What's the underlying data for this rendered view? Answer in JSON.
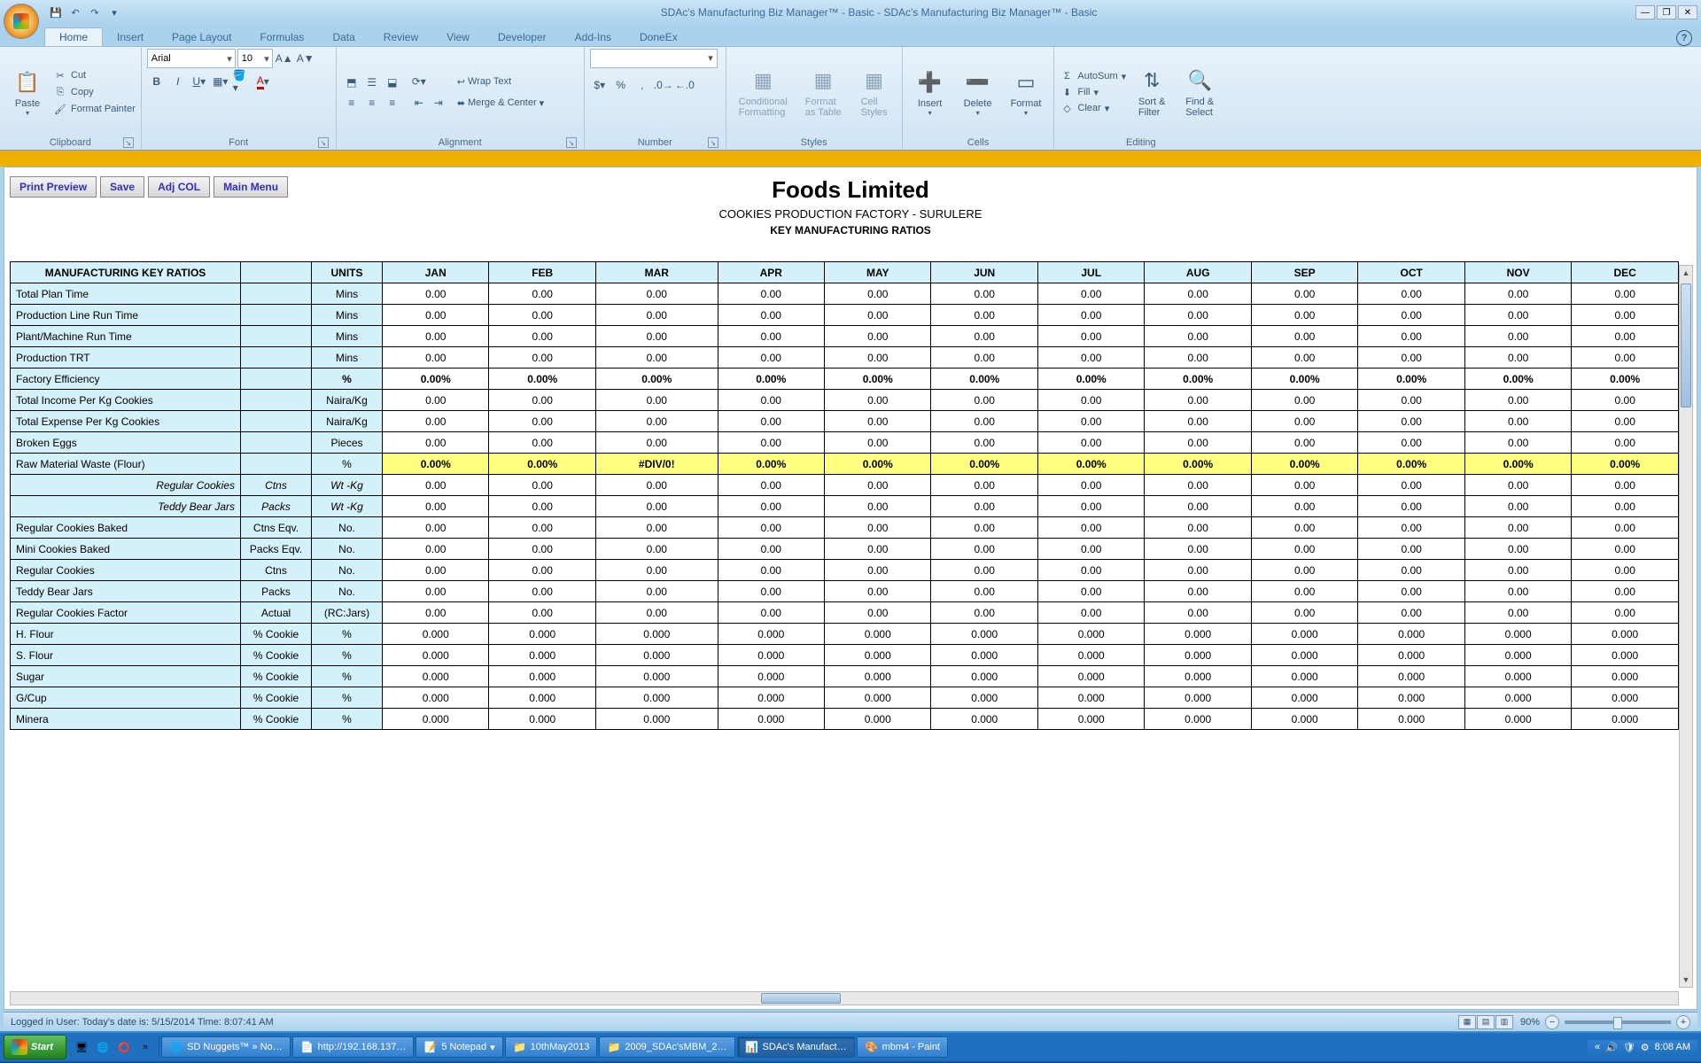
{
  "window": {
    "title": "SDAc's Manufacturing Biz Manager™ - Basic - SDAc's Manufacturing Biz Manager™ - Basic"
  },
  "ribbon": {
    "tabs": [
      "Home",
      "Insert",
      "Page Layout",
      "Formulas",
      "Data",
      "Review",
      "View",
      "Developer",
      "Add-Ins",
      "DoneEx"
    ],
    "active_tab": "Home",
    "clipboard": {
      "label": "Clipboard",
      "paste": "Paste",
      "cut": "Cut",
      "copy": "Copy",
      "fpainter": "Format Painter"
    },
    "font": {
      "label": "Font",
      "name": "Arial",
      "size": "10"
    },
    "alignment": {
      "label": "Alignment",
      "wrap": "Wrap Text",
      "merge": "Merge & Center"
    },
    "number": {
      "label": "Number"
    },
    "styles": {
      "label": "Styles",
      "cond": "Conditional\nFormatting",
      "table": "Format\nas Table",
      "cell": "Cell\nStyles"
    },
    "cells": {
      "label": "Cells",
      "insert": "Insert",
      "delete": "Delete",
      "format": "Format"
    },
    "editing": {
      "label": "Editing",
      "autosum": "AutoSum",
      "fill": "Fill",
      "clear": "Clear",
      "sort": "Sort &\nFilter",
      "find": "Find &\nSelect"
    }
  },
  "sheet_buttons": {
    "preview": "Print Preview",
    "save": "Save",
    "adj": "Adj COL",
    "main": "Main Menu"
  },
  "report": {
    "company": "Foods Limited",
    "factory": "COOKIES PRODUCTION FACTORY - SURULERE",
    "title": "KEY MANUFACTURING RATIOS",
    "head_main": "MANUFACTURING KEY RATIOS",
    "head_units": "UNITS",
    "months": [
      "JAN",
      "FEB",
      "MAR",
      "APR",
      "MAY",
      "JUN",
      "JUL",
      "AUG",
      "SEP",
      "OCT",
      "NOV",
      "DEC"
    ]
  },
  "rows": [
    {
      "label": "Total Plan Time",
      "col2": "",
      "unit": "Mins",
      "fmt": "0.00",
      "vals": [
        0,
        0,
        0,
        0,
        0,
        0,
        0,
        0,
        0,
        0,
        0,
        0
      ]
    },
    {
      "label": "Production Line Run Time",
      "col2": "",
      "unit": "Mins",
      "fmt": "0.00",
      "vals": [
        0,
        0,
        0,
        0,
        0,
        0,
        0,
        0,
        0,
        0,
        0,
        0
      ]
    },
    {
      "label": "Plant/Machine Run Time",
      "col2": "",
      "unit": "Mins",
      "fmt": "0.00",
      "vals": [
        0,
        0,
        0,
        0,
        0,
        0,
        0,
        0,
        0,
        0,
        0,
        0
      ]
    },
    {
      "label": "Production TRT",
      "col2": "",
      "unit": "Mins",
      "fmt": "0.00",
      "vals": [
        0,
        0,
        0,
        0,
        0,
        0,
        0,
        0,
        0,
        0,
        0,
        0
      ]
    },
    {
      "label": "Factory Efficiency",
      "col2": "",
      "unit": "%",
      "fmt": "0.00%",
      "bold": true,
      "vals": [
        0,
        0,
        0,
        0,
        0,
        0,
        0,
        0,
        0,
        0,
        0,
        0
      ]
    },
    {
      "label": "Total Income Per Kg Cookies",
      "col2": "",
      "unit": "Naira/Kg",
      "fmt": "0.00",
      "vals": [
        0,
        0,
        0,
        0,
        0,
        0,
        0,
        0,
        0,
        0,
        0,
        0
      ]
    },
    {
      "label": "Total Expense Per Kg Cookies",
      "col2": "",
      "unit": "Naira/Kg",
      "fmt": "0.00",
      "vals": [
        0,
        0,
        0,
        0,
        0,
        0,
        0,
        0,
        0,
        0,
        0,
        0
      ]
    },
    {
      "label": "Broken Eggs",
      "col2": "",
      "unit": "Pieces",
      "fmt": "0.00",
      "vals": [
        0,
        0,
        0,
        0,
        0,
        0,
        0,
        0,
        0,
        0,
        0,
        0
      ]
    },
    {
      "label": "Raw Material Waste (Flour)",
      "col2": "",
      "unit": "%",
      "fmt": "0.00%",
      "yellow": true,
      "vals": [
        0,
        0,
        "#DIV/0!",
        0,
        0,
        0,
        0,
        0,
        0,
        0,
        0,
        0
      ]
    },
    {
      "label": "Regular Cookies",
      "sub": true,
      "col2": "Ctns",
      "unit": "Wt -Kg",
      "unit_it": true,
      "fmt": "0.00",
      "vals": [
        0,
        0,
        0,
        0,
        0,
        0,
        0,
        0,
        0,
        0,
        0,
        0
      ]
    },
    {
      "label": "Teddy Bear Jars",
      "sub": true,
      "col2": "Packs",
      "unit": "Wt -Kg",
      "unit_it": true,
      "fmt": "0.00",
      "vals": [
        0,
        0,
        0,
        0,
        0,
        0,
        0,
        0,
        0,
        0,
        0,
        0
      ]
    },
    {
      "label": "Regular Cookies Baked",
      "col2": "Ctns Eqv.",
      "unit": "No.",
      "fmt": "0.00",
      "vals": [
        0,
        0,
        0,
        0,
        0,
        0,
        0,
        0,
        0,
        0,
        0,
        0
      ]
    },
    {
      "label": "Mini Cookies Baked",
      "col2": "Packs Eqv.",
      "unit": "No.",
      "fmt": "0.00",
      "vals": [
        0,
        0,
        0,
        0,
        0,
        0,
        0,
        0,
        0,
        0,
        0,
        0
      ]
    },
    {
      "label": "Regular Cookies",
      "col2": "Ctns",
      "unit": "No.",
      "fmt": "0.00",
      "vals": [
        0,
        0,
        0,
        0,
        0,
        0,
        0,
        0,
        0,
        0,
        0,
        0
      ]
    },
    {
      "label": "Teddy Bear Jars",
      "col2": "Packs",
      "unit": "No.",
      "fmt": "0.00",
      "vals": [
        0,
        0,
        0,
        0,
        0,
        0,
        0,
        0,
        0,
        0,
        0,
        0
      ]
    },
    {
      "label": "Regular Cookies Factor",
      "col2": "Actual",
      "unit": "(RC:Jars)",
      "fmt": "0.00",
      "vals": [
        0,
        0,
        0,
        0,
        0,
        0,
        0,
        0,
        0,
        0,
        0,
        0
      ]
    },
    {
      "label": "H. Flour",
      "col2": "% Cookie",
      "unit": "%",
      "fmt": "0.000",
      "vals": [
        0,
        0,
        0,
        0,
        0,
        0,
        0,
        0,
        0,
        0,
        0,
        0
      ]
    },
    {
      "label": "S. Flour",
      "col2": "% Cookie",
      "unit": "%",
      "fmt": "0.000",
      "vals": [
        0,
        0,
        0,
        0,
        0,
        0,
        0,
        0,
        0,
        0,
        0,
        0
      ]
    },
    {
      "label": "Sugar",
      "col2": "% Cookie",
      "unit": "%",
      "fmt": "0.000",
      "vals": [
        0,
        0,
        0,
        0,
        0,
        0,
        0,
        0,
        0,
        0,
        0,
        0
      ]
    },
    {
      "label": "G/Cup",
      "col2": "% Cookie",
      "unit": "%",
      "fmt": "0.000",
      "vals": [
        0,
        0,
        0,
        0,
        0,
        0,
        0,
        0,
        0,
        0,
        0,
        0
      ]
    },
    {
      "label": "Minera",
      "col2": "% Cookie",
      "unit": "%",
      "fmt": "0.000",
      "vals": [
        0,
        0,
        0,
        0,
        0,
        0,
        0,
        0,
        0,
        0,
        0,
        0
      ]
    }
  ],
  "status": {
    "text": "Logged in User:  Today's date is: 5/15/2014 Time: 8:07:41 AM",
    "zoom": "90%"
  },
  "taskbar": {
    "start": "Start",
    "items": [
      {
        "icon": "🌐",
        "label": "SD Nuggets™ » No…"
      },
      {
        "icon": "📄",
        "label": "http://192.168.137…"
      },
      {
        "icon": "📝",
        "label": "5 Notepad",
        "drop": true
      },
      {
        "icon": "📁",
        "label": "10thMay2013"
      },
      {
        "icon": "📁",
        "label": "2009_SDAc'sMBM_2…"
      },
      {
        "icon": "📊",
        "label": "SDAc's Manufact…",
        "active": true
      },
      {
        "icon": "🎨",
        "label": "mbm4 - Paint"
      }
    ],
    "time": "8:08 AM"
  }
}
